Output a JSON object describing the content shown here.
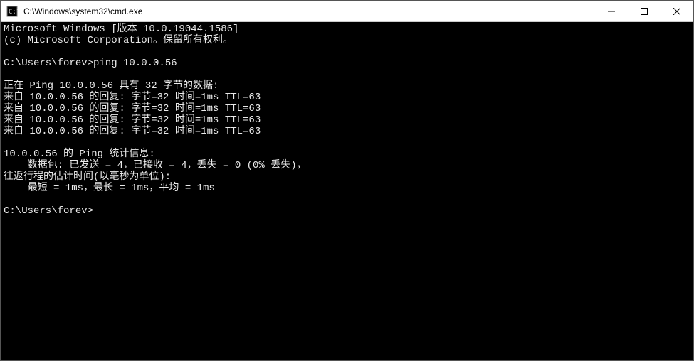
{
  "window": {
    "title": "C:\\Windows\\system32\\cmd.exe"
  },
  "terminal": {
    "lines": [
      "Microsoft Windows [版本 10.0.19044.1586]",
      "(c) Microsoft Corporation。保留所有权利。",
      "",
      "C:\\Users\\forev>ping 10.0.0.56",
      "",
      "正在 Ping 10.0.0.56 具有 32 字节的数据:",
      "来自 10.0.0.56 的回复: 字节=32 时间=1ms TTL=63",
      "来自 10.0.0.56 的回复: 字节=32 时间=1ms TTL=63",
      "来自 10.0.0.56 的回复: 字节=32 时间=1ms TTL=63",
      "来自 10.0.0.56 的回复: 字节=32 时间=1ms TTL=63",
      "",
      "10.0.0.56 的 Ping 统计信息:",
      "    数据包: 已发送 = 4，已接收 = 4，丢失 = 0 (0% 丢失)，",
      "往返行程的估计时间(以毫秒为单位):",
      "    最短 = 1ms，最长 = 1ms，平均 = 1ms",
      "",
      "C:\\Users\\forev>"
    ]
  }
}
